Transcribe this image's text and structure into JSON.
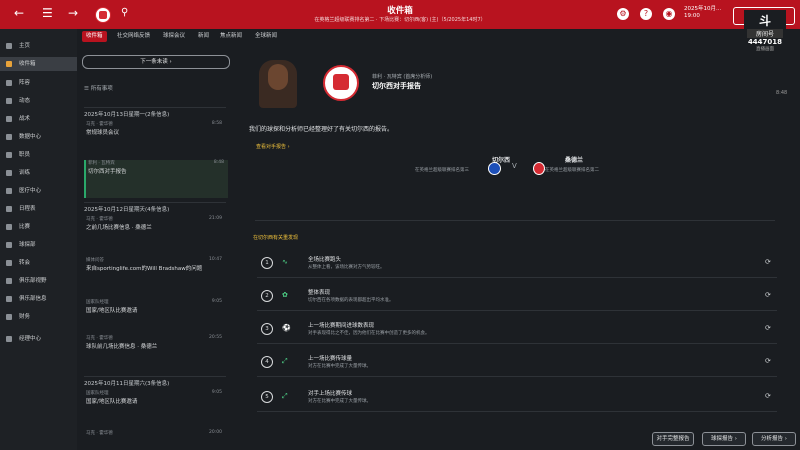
{
  "topbar": {
    "title": "收件箱",
    "subtitle": "在英格兰超级联赛排名第二 · 下场比赛：切尔西(客) (主)（5/2025年14时7）",
    "date_line1": "2025年10月...",
    "date_line2": "19:00",
    "continue_label": "继续",
    "nav_back": "←",
    "nav_forward": "→",
    "menu": "☰"
  },
  "stream": {
    "logo": "斗",
    "sub": "房间号",
    "number": "4447018",
    "caption": "直播画面",
    "time": "8:48"
  },
  "sidebar": {
    "items": [
      {
        "label": "主页"
      },
      {
        "label": "收件箱"
      },
      {
        "label": "阵容"
      },
      {
        "label": "动态"
      },
      {
        "label": "战术"
      },
      {
        "label": "数据中心"
      },
      {
        "label": "职员"
      },
      {
        "label": "训练"
      },
      {
        "label": "医疗中心"
      },
      {
        "label": "日程表"
      },
      {
        "label": "比赛"
      },
      {
        "label": "球探部"
      },
      {
        "label": "转会"
      },
      {
        "label": "俱乐部视野"
      },
      {
        "label": "俱乐部信息"
      },
      {
        "label": "财务"
      },
      {
        "label": "经理中心"
      }
    ]
  },
  "tabs": [
    "收件箱",
    "社交网络反馈",
    "球探会议",
    "新闻",
    "焦点新闻",
    "全球新闻"
  ],
  "inbox": {
    "next_label": "下一条未读",
    "filter_label": "所有事项",
    "groups": [
      {
        "label": "2025年10月13日星期一(2条信息)"
      },
      {
        "label": "2025年10月12日星期天(4条信息)"
      },
      {
        "label": "2025年10月11日星期六(3条信息)"
      }
    ],
    "messages": [
      {
        "from": "马克 · 霍华德",
        "subject": "常规球员会议",
        "time": "8:58"
      },
      {
        "from": "菲利 · 瓦特宾",
        "subject": "切尔西对手报告",
        "time": "8:48"
      },
      {
        "from": "马克 · 霍华德",
        "subject": "之前几场比赛信息 · 桑德兰",
        "time": "21:09"
      },
      {
        "from": "媒体问答",
        "subject": "来自sportinglife.com的Will Bradshaw的问题",
        "time": "10:47"
      },
      {
        "from": "国家队经理",
        "subject": "国家/地区队比赛邀请",
        "time": "9:05"
      },
      {
        "from": "马克 · 霍华德",
        "subject": "球队前几场比赛信息 · 桑德兰",
        "time": "20:55"
      },
      {
        "from": "国家队经理",
        "subject": "国家/地区队比赛邀请",
        "time": "9:05"
      },
      {
        "from": "马克 · 霍华德",
        "subject": "",
        "time": "20:00"
      }
    ]
  },
  "main": {
    "sender_role": "菲利 · 瓦特宾 (首席分析师)",
    "title": "切尔西对手报告",
    "body": "我们的球探和分析师已经整理好了有关切尔西的报告。",
    "link": "查看对手报告 ›",
    "team_left": "切尔西",
    "team_left_sub": "在英格兰超级联赛排名第三",
    "vs": "V",
    "team_right": "桑德兰",
    "team_right_sub": "在英格兰超级联赛排名第二",
    "section_header": "在切尔西有关重发现",
    "findings": [
      {
        "num": "1",
        "title": "全场比赛跑头",
        "desc": "从整体上看，该场比赛对方气势较旺。"
      },
      {
        "num": "2",
        "title": "整体表现",
        "desc": "切尔西在各项数据的表现都超出平均水准。"
      },
      {
        "num": "3",
        "title": "上一场比赛期间进球数表现",
        "desc": "对手表现得比之不佳，因为他们在比赛中创造了更多的机会。"
      },
      {
        "num": "4",
        "title": "上一场比赛传球量",
        "desc": "对方在比赛中完成了大量传球。"
      },
      {
        "num": "5",
        "title": "对手上场比赛传球",
        "desc": "对方在比赛中完成了大量传球。"
      }
    ]
  },
  "bottom_buttons": [
    "对手完整报告",
    "球探报告 ›",
    "分析报告 ›"
  ],
  "colors": {
    "accent": "#b8131f",
    "highlight": "#2aa86a",
    "link": "#f0c23c"
  }
}
